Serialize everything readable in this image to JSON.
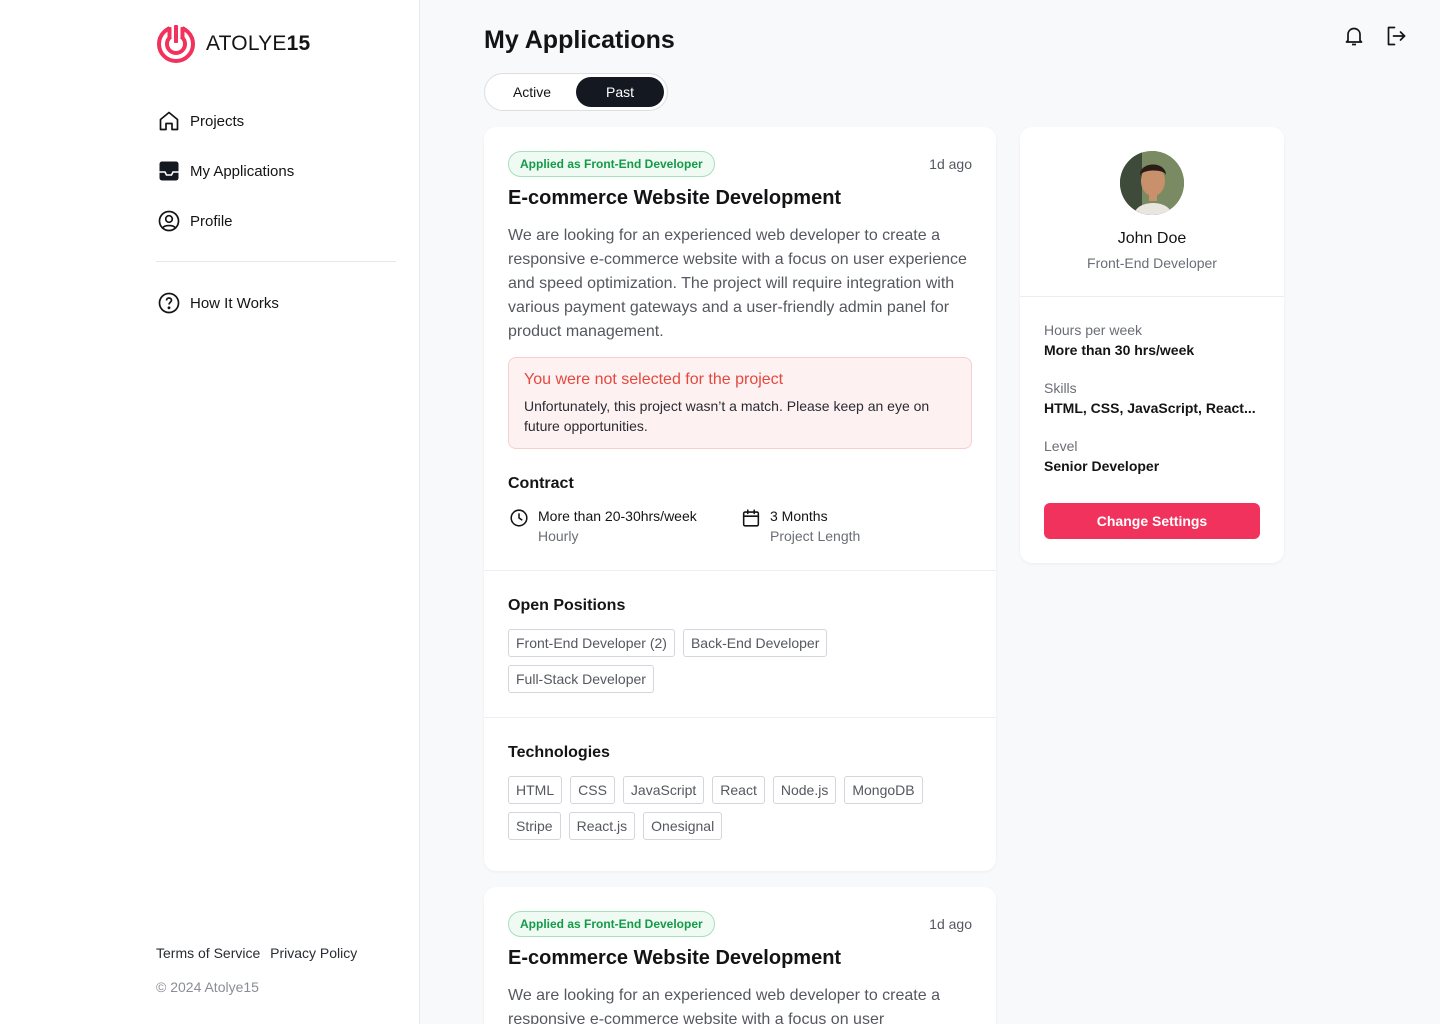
{
  "brand": {
    "name_light": "ATOLYE",
    "name_bold": "15",
    "accent": "#f1325c"
  },
  "nav": {
    "items": [
      {
        "label": "Projects",
        "icon": "home-icon"
      },
      {
        "label": "My Applications",
        "icon": "inbox-icon"
      },
      {
        "label": "Profile",
        "icon": "user-circle-icon"
      }
    ],
    "secondary": [
      {
        "label": "How It Works",
        "icon": "help-icon"
      }
    ]
  },
  "footer": {
    "terms": "Terms of Service",
    "privacy": "Privacy Policy",
    "copyright": "© 2024 Atolye15"
  },
  "header": {
    "title": "My Applications"
  },
  "toggle": {
    "active": "Active",
    "past": "Past",
    "selected": "Past"
  },
  "applications": [
    {
      "badge": "Applied as Front-End Developer",
      "time": "1d ago",
      "title": "E-commerce Website Development",
      "description": "We are looking for an experienced web developer to create a responsive e-commerce website with a focus on user experience and speed optimization. The project will require integration with various payment gateways and a user-friendly admin panel for product management.",
      "alert": {
        "title": "You were not selected for the project",
        "text": "Unfortunately, this project wasn’t a match. Please keep an eye on future opportunities."
      },
      "contract": {
        "heading": "Contract",
        "hours": "More than 20-30hrs/week",
        "hours_sub": "Hourly",
        "length": "3 Months",
        "length_sub": "Project Length"
      },
      "positions": {
        "heading": "Open Positions",
        "items": [
          "Front-End Developer (2)",
          "Back-End Developer",
          "Full-Stack Developer"
        ]
      },
      "technologies": {
        "heading": "Technologies",
        "items": [
          "HTML",
          "CSS",
          "JavaScript",
          "React",
          "Node.js",
          "MongoDB",
          "Stripe",
          "React.js",
          "Onesignal"
        ]
      }
    },
    {
      "badge": "Applied as Front-End Developer",
      "time": "1d ago",
      "title": "E-commerce Website Development",
      "description": "We are looking for an experienced web developer to create a responsive e-commerce website with a focus on user"
    }
  ],
  "profile": {
    "name": "John Doe",
    "role": "Front-End Developer",
    "hours_label": "Hours per week",
    "hours_value": "More than 30 hrs/week",
    "skills_label": "Skills",
    "skills_value": "HTML, CSS, JavaScript, React...",
    "level_label": "Level",
    "level_value": "Senior Developer",
    "button": "Change Settings"
  }
}
